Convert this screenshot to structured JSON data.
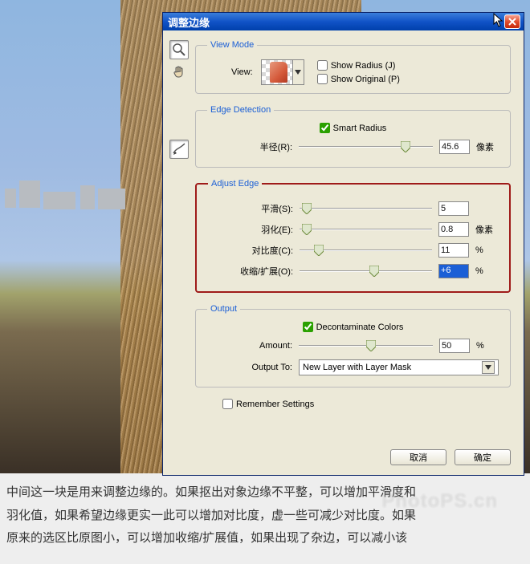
{
  "dialog": {
    "title": "调整边缘",
    "close_aria": "Close"
  },
  "view_mode": {
    "legend": "View Mode",
    "label": "View:",
    "show_radius": "Show Radius (J)",
    "show_original": "Show Original (P)"
  },
  "edge_detection": {
    "legend": "Edge Detection",
    "smart_radius": "Smart Radius",
    "radius": {
      "label": "半径(R):",
      "value": "45.6",
      "pos": 0.76,
      "unit": "像素"
    }
  },
  "adjust_edge": {
    "legend": "Adjust Edge",
    "smooth": {
      "label": "平滑(S):",
      "value": "5",
      "pos": 0.02,
      "unit": ""
    },
    "feather": {
      "label": "羽化(E):",
      "value": "0.8",
      "pos": 0.02,
      "unit": "像素"
    },
    "contrast": {
      "label": "对比度(C):",
      "value": "11",
      "pos": 0.11,
      "unit": "%"
    },
    "shift": {
      "label": "收缩/扩展(O):",
      "value": "+6",
      "pos": 0.53,
      "unit": "%"
    }
  },
  "output": {
    "legend": "Output",
    "decontaminate": "Decontaminate Colors",
    "amount": {
      "label": "Amount:",
      "value": "50",
      "pos": 0.5,
      "unit": "%"
    },
    "output_to_label": "Output To:",
    "output_to_value": "New Layer with Layer Mask"
  },
  "remember": "Remember Settings",
  "buttons": {
    "cancel": "取消",
    "ok": "确定"
  },
  "caption": {
    "l1": "中间这一块是用来调整边缘的。如果抠出对象边缘不平整，可以增加平滑度和",
    "l2": "羽化值，如果希望边缘更实一此可以增加对比度，虚一些可减少对比度。如果",
    "l3": "原来的选区比原图小，可以增加收缩/扩展值，如果出现了杂边，可以减小该"
  }
}
